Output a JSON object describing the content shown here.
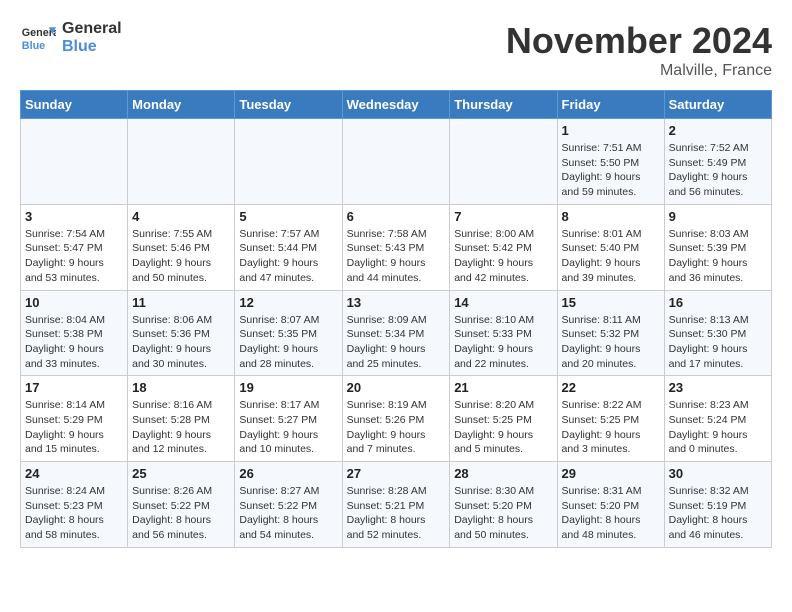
{
  "header": {
    "logo_line1": "General",
    "logo_line2": "Blue",
    "month": "November 2024",
    "location": "Malville, France"
  },
  "weekdays": [
    "Sunday",
    "Monday",
    "Tuesday",
    "Wednesday",
    "Thursday",
    "Friday",
    "Saturday"
  ],
  "weeks": [
    [
      {
        "day": "",
        "details": ""
      },
      {
        "day": "",
        "details": ""
      },
      {
        "day": "",
        "details": ""
      },
      {
        "day": "",
        "details": ""
      },
      {
        "day": "",
        "details": ""
      },
      {
        "day": "1",
        "details": "Sunrise: 7:51 AM\nSunset: 5:50 PM\nDaylight: 9 hours and 59 minutes."
      },
      {
        "day": "2",
        "details": "Sunrise: 7:52 AM\nSunset: 5:49 PM\nDaylight: 9 hours and 56 minutes."
      }
    ],
    [
      {
        "day": "3",
        "details": "Sunrise: 7:54 AM\nSunset: 5:47 PM\nDaylight: 9 hours and 53 minutes."
      },
      {
        "day": "4",
        "details": "Sunrise: 7:55 AM\nSunset: 5:46 PM\nDaylight: 9 hours and 50 minutes."
      },
      {
        "day": "5",
        "details": "Sunrise: 7:57 AM\nSunset: 5:44 PM\nDaylight: 9 hours and 47 minutes."
      },
      {
        "day": "6",
        "details": "Sunrise: 7:58 AM\nSunset: 5:43 PM\nDaylight: 9 hours and 44 minutes."
      },
      {
        "day": "7",
        "details": "Sunrise: 8:00 AM\nSunset: 5:42 PM\nDaylight: 9 hours and 42 minutes."
      },
      {
        "day": "8",
        "details": "Sunrise: 8:01 AM\nSunset: 5:40 PM\nDaylight: 9 hours and 39 minutes."
      },
      {
        "day": "9",
        "details": "Sunrise: 8:03 AM\nSunset: 5:39 PM\nDaylight: 9 hours and 36 minutes."
      }
    ],
    [
      {
        "day": "10",
        "details": "Sunrise: 8:04 AM\nSunset: 5:38 PM\nDaylight: 9 hours and 33 minutes."
      },
      {
        "day": "11",
        "details": "Sunrise: 8:06 AM\nSunset: 5:36 PM\nDaylight: 9 hours and 30 minutes."
      },
      {
        "day": "12",
        "details": "Sunrise: 8:07 AM\nSunset: 5:35 PM\nDaylight: 9 hours and 28 minutes."
      },
      {
        "day": "13",
        "details": "Sunrise: 8:09 AM\nSunset: 5:34 PM\nDaylight: 9 hours and 25 minutes."
      },
      {
        "day": "14",
        "details": "Sunrise: 8:10 AM\nSunset: 5:33 PM\nDaylight: 9 hours and 22 minutes."
      },
      {
        "day": "15",
        "details": "Sunrise: 8:11 AM\nSunset: 5:32 PM\nDaylight: 9 hours and 20 minutes."
      },
      {
        "day": "16",
        "details": "Sunrise: 8:13 AM\nSunset: 5:30 PM\nDaylight: 9 hours and 17 minutes."
      }
    ],
    [
      {
        "day": "17",
        "details": "Sunrise: 8:14 AM\nSunset: 5:29 PM\nDaylight: 9 hours and 15 minutes."
      },
      {
        "day": "18",
        "details": "Sunrise: 8:16 AM\nSunset: 5:28 PM\nDaylight: 9 hours and 12 minutes."
      },
      {
        "day": "19",
        "details": "Sunrise: 8:17 AM\nSunset: 5:27 PM\nDaylight: 9 hours and 10 minutes."
      },
      {
        "day": "20",
        "details": "Sunrise: 8:19 AM\nSunset: 5:26 PM\nDaylight: 9 hours and 7 minutes."
      },
      {
        "day": "21",
        "details": "Sunrise: 8:20 AM\nSunset: 5:25 PM\nDaylight: 9 hours and 5 minutes."
      },
      {
        "day": "22",
        "details": "Sunrise: 8:22 AM\nSunset: 5:25 PM\nDaylight: 9 hours and 3 minutes."
      },
      {
        "day": "23",
        "details": "Sunrise: 8:23 AM\nSunset: 5:24 PM\nDaylight: 9 hours and 0 minutes."
      }
    ],
    [
      {
        "day": "24",
        "details": "Sunrise: 8:24 AM\nSunset: 5:23 PM\nDaylight: 8 hours and 58 minutes."
      },
      {
        "day": "25",
        "details": "Sunrise: 8:26 AM\nSunset: 5:22 PM\nDaylight: 8 hours and 56 minutes."
      },
      {
        "day": "26",
        "details": "Sunrise: 8:27 AM\nSunset: 5:22 PM\nDaylight: 8 hours and 54 minutes."
      },
      {
        "day": "27",
        "details": "Sunrise: 8:28 AM\nSunset: 5:21 PM\nDaylight: 8 hours and 52 minutes."
      },
      {
        "day": "28",
        "details": "Sunrise: 8:30 AM\nSunset: 5:20 PM\nDaylight: 8 hours and 50 minutes."
      },
      {
        "day": "29",
        "details": "Sunrise: 8:31 AM\nSunset: 5:20 PM\nDaylight: 8 hours and 48 minutes."
      },
      {
        "day": "30",
        "details": "Sunrise: 8:32 AM\nSunset: 5:19 PM\nDaylight: 8 hours and 46 minutes."
      }
    ]
  ]
}
